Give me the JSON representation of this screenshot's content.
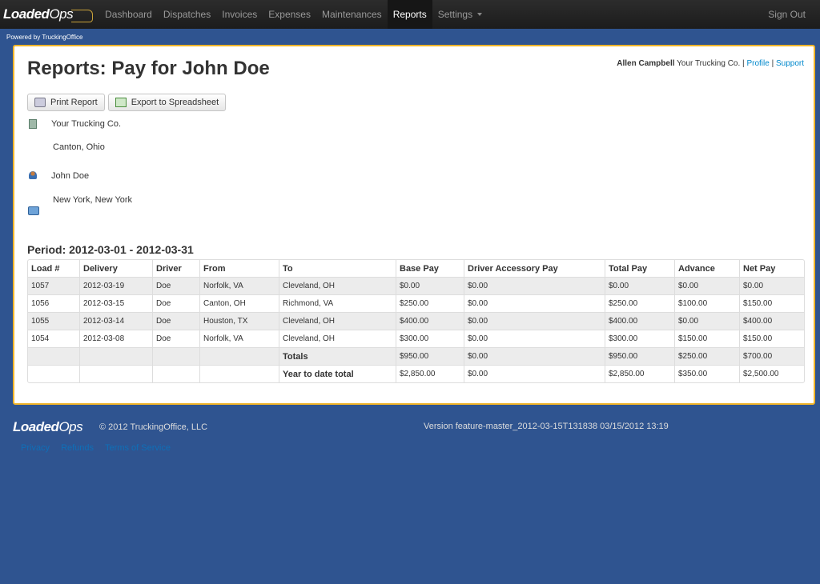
{
  "nav": {
    "brand_bold": "Loaded",
    "brand_light": "Ops",
    "items": [
      {
        "label": "Dashboard",
        "active": false
      },
      {
        "label": "Dispatches",
        "active": false
      },
      {
        "label": "Invoices",
        "active": false
      },
      {
        "label": "Expenses",
        "active": false
      },
      {
        "label": "Maintenances",
        "active": false
      },
      {
        "label": "Reports",
        "active": true
      },
      {
        "label": "Settings",
        "active": false,
        "dropdown": true
      }
    ],
    "sign_out": "Sign Out"
  },
  "powered_by": "Powered by TruckingOffice",
  "header": {
    "title": "Reports: Pay for John Doe",
    "user_name": "Allen Campbell",
    "company": "Your Trucking Co.",
    "separator": "|",
    "profile_link": "Profile",
    "support_link": "Support"
  },
  "toolbar": {
    "print_label": "Print Report",
    "export_label": "Export to Spreadsheet"
  },
  "company_info": {
    "name": "Your Trucking Co.",
    "location": "Canton, Ohio"
  },
  "driver_info": {
    "name": "John Doe",
    "location": "New York, New York"
  },
  "period": "Period: 2012-03-01 - 2012-03-31",
  "table": {
    "columns": [
      "Load #",
      "Delivery",
      "Driver",
      "From",
      "To",
      "Base Pay",
      "Driver Accessory Pay",
      "Total Pay",
      "Advance",
      "Net Pay"
    ],
    "rows": [
      [
        "1057",
        "2012-03-19",
        "Doe",
        "Norfolk, VA",
        "Cleveland, OH",
        "$0.00",
        "$0.00",
        "$0.00",
        "$0.00",
        "$0.00"
      ],
      [
        "1056",
        "2012-03-15",
        "Doe",
        "Canton, OH",
        "Richmond, VA",
        "$250.00",
        "$0.00",
        "$250.00",
        "$100.00",
        "$150.00"
      ],
      [
        "1055",
        "2012-03-14",
        "Doe",
        "Houston, TX",
        "Cleveland, OH",
        "$400.00",
        "$0.00",
        "$400.00",
        "$0.00",
        "$400.00"
      ],
      [
        "1054",
        "2012-03-08",
        "Doe",
        "Norfolk, VA",
        "Cleveland, OH",
        "$300.00",
        "$0.00",
        "$300.00",
        "$150.00",
        "$150.00"
      ]
    ],
    "totals": {
      "label": "Totals",
      "values": [
        "$950.00",
        "$0.00",
        "$950.00",
        "$250.00",
        "$700.00"
      ]
    },
    "ytd": {
      "label": "Year to date total",
      "values": [
        "$2,850.00",
        "$0.00",
        "$2,850.00",
        "$350.00",
        "$2,500.00"
      ]
    }
  },
  "footer": {
    "copyright": "© 2012 TruckingOffice, LLC",
    "version": "Version feature-master_2012-03-15T131838 03/15/2012 13:19",
    "links": [
      "Privacy",
      "Refunds",
      "Terms of Service"
    ]
  },
  "colors": {
    "background": "#2f5490",
    "panel_border": "#f0b429",
    "link": "#0088cc"
  }
}
